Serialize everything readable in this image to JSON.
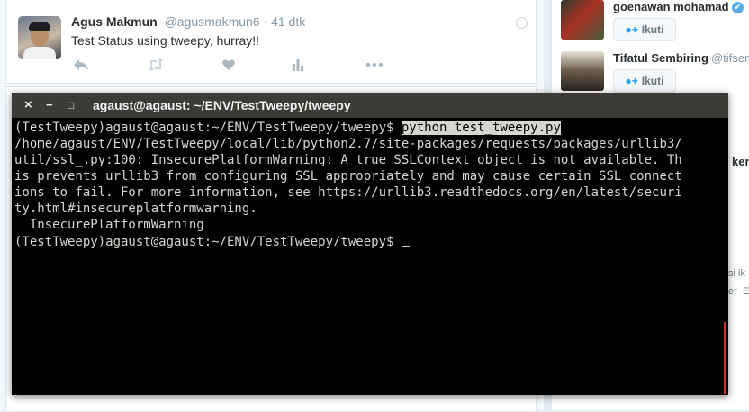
{
  "tweet": {
    "name": "Agus Makmun",
    "handle": "@agusmakmun6",
    "separator": "·",
    "time": "41 dtk",
    "text": "Test Status using tweepy, hurray!!"
  },
  "sidebar": {
    "items": [
      {
        "name": "goenawan mohamad",
        "handle": "",
        "follow_label": "Ikuti"
      },
      {
        "name": "Tifatul Sembiring",
        "handle": "@tifsem",
        "follow_label": "Ikuti"
      }
    ],
    "fragments": {
      "a": "ker",
      "b": "si ik",
      "c": "er",
      "d": "E"
    }
  },
  "terminal": {
    "title": "agaust@agaust: ~/ENV/TestTweepy/tweepy",
    "close": "×",
    "minimize": "−",
    "maximize": "□",
    "prompt1": "(TestTweepy)agaust@agaust:~/ENV/TestTweepy/tweepy$ ",
    "command": "python test_tweepy.py",
    "line2": "/home/agaust/ENV/TestTweepy/local/lib/python2.7/site-packages/requests/packages/urllib3/",
    "line3": "util/ssl_.py:100: InsecurePlatformWarning: A true SSLContext object is not available. Th",
    "line4": "is prevents urllib3 from configuring SSL appropriately and may cause certain SSL connect",
    "line5": "ions to fail. For more information, see https://urllib3.readthedocs.org/en/latest/securi",
    "line6": "ty.html#insecureplatformwarning.",
    "line7": "  InsecurePlatformWarning",
    "prompt2": "(TestTweepy)agaust@agaust:~/ENV/TestTweepy/tweepy$ "
  },
  "colors": {
    "terminal_bg": "#000000",
    "terminal_fg": "#d3d7cf",
    "titlebar": "#3c3b37",
    "twitter_blue": "#1da1f2"
  }
}
